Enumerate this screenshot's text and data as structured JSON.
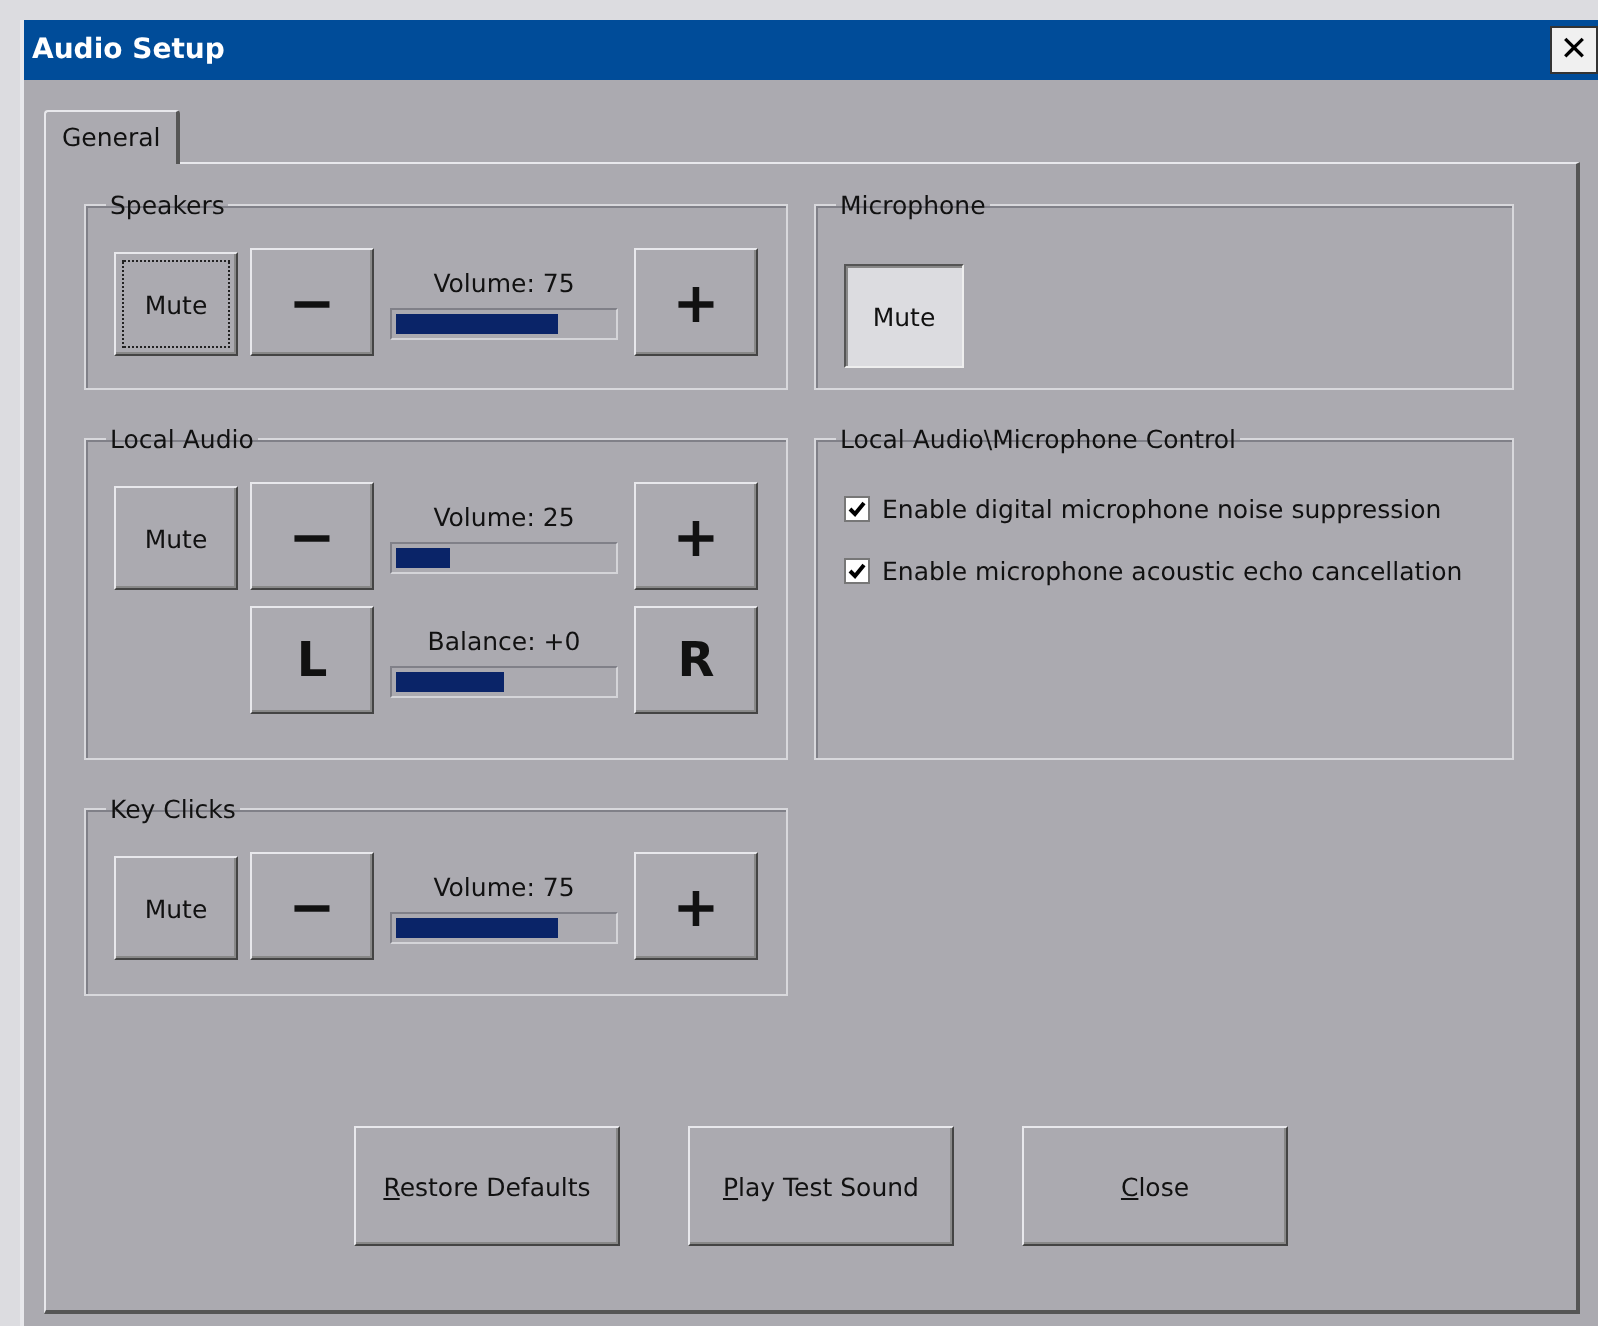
{
  "window": {
    "title": "Audio Setup",
    "close": "✕"
  },
  "tabs": [
    {
      "label": "General",
      "selected": true
    }
  ],
  "left_groups": [
    {
      "title": "Speakers",
      "mute": {
        "label": "Mute",
        "pressed": false,
        "focused": true
      },
      "sliders": [
        {
          "dec": "−",
          "label": "Volume: 75",
          "level": 0.75,
          "inc": "+"
        }
      ]
    },
    {
      "title": "Local Audio",
      "mute": {
        "label": "Mute",
        "pressed": false,
        "focused": false
      },
      "sliders": [
        {
          "dec": "−",
          "label": "Volume: 25",
          "level": 0.25,
          "inc": "+"
        },
        {
          "dec": "L",
          "label": "Balance: +0",
          "level": 0.5,
          "inc": "R"
        }
      ]
    },
    {
      "title": "Key Clicks",
      "mute": {
        "label": "Mute",
        "pressed": false,
        "focused": false
      },
      "sliders": [
        {
          "dec": "−",
          "label": "Volume: 75",
          "level": 0.75,
          "inc": "+"
        }
      ]
    }
  ],
  "right_groups": [
    {
      "title": "Microphone",
      "mute": {
        "label": "Mute",
        "pressed": true,
        "focused": false
      }
    },
    {
      "title": "Local Audio\\Microphone Control",
      "options": [
        {
          "label": "Enable digital microphone noise suppression",
          "checked": true
        },
        {
          "label": "Enable microphone acoustic echo cancellation",
          "checked": true
        }
      ]
    }
  ],
  "buttons": [
    {
      "label": "Restore Defaults",
      "first_letter_underlined": true
    },
    {
      "label": "Play Test Sound",
      "first_letter_underlined": true
    },
    {
      "label": "Close",
      "first_letter_underlined": true
    }
  ]
}
